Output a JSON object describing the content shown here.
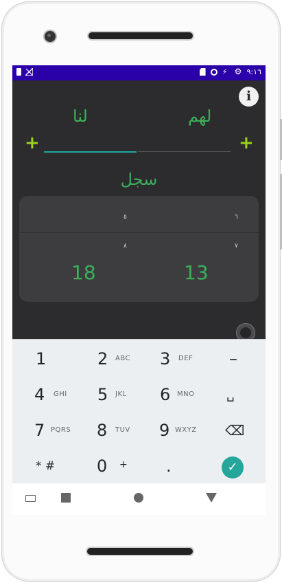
{
  "status_bar": {
    "time": "٩:١٦",
    "left_icons": [
      "battery-icon",
      "no-sim-icon"
    ],
    "right_icons": [
      "sd-card-icon",
      "sync-icon",
      "signal-icon",
      "gear-icon"
    ],
    "background": "#2a00a8"
  },
  "app": {
    "team_us": "لنا",
    "team_them": "لهم",
    "add_us_label": "+",
    "add_them_label": "+",
    "record_label": "سجل",
    "info_label": "i",
    "history": [
      {
        "us": "٥",
        "them": "٦"
      },
      {
        "us": "٨",
        "them": "٧"
      }
    ],
    "total_us": "18",
    "total_them": "13",
    "accent": "#3cb05a",
    "plus_color": "#9bd21c",
    "input_accent": "#1fa9a0"
  },
  "keyboard": {
    "rows": [
      [
        {
          "num": "1",
          "letters": ""
        },
        {
          "num": "2",
          "letters": "ABC"
        },
        {
          "num": "3",
          "letters": "DEF"
        },
        {
          "num": "–",
          "letters": ""
        }
      ],
      [
        {
          "num": "4",
          "letters": "GHI"
        },
        {
          "num": "5",
          "letters": "JKL"
        },
        {
          "num": "6",
          "letters": "MNO"
        },
        {
          "num": "␣",
          "letters": ""
        }
      ],
      [
        {
          "num": "7",
          "letters": "PQRS"
        },
        {
          "num": "8",
          "letters": "TUV"
        },
        {
          "num": "9",
          "letters": "WXYZ"
        },
        {
          "num": "⌫",
          "letters": ""
        }
      ],
      [
        {
          "num": "* #",
          "letters": ""
        },
        {
          "num": "0",
          "letters": "+"
        },
        {
          "num": ".",
          "letters": ""
        },
        {
          "num": "✓",
          "letters": ""
        }
      ]
    ],
    "confirm_color": "#26a69a"
  },
  "nav_bar": {
    "buttons": [
      "keyboard-switch-icon",
      "back-icon",
      "home-icon",
      "recents-icon"
    ]
  }
}
